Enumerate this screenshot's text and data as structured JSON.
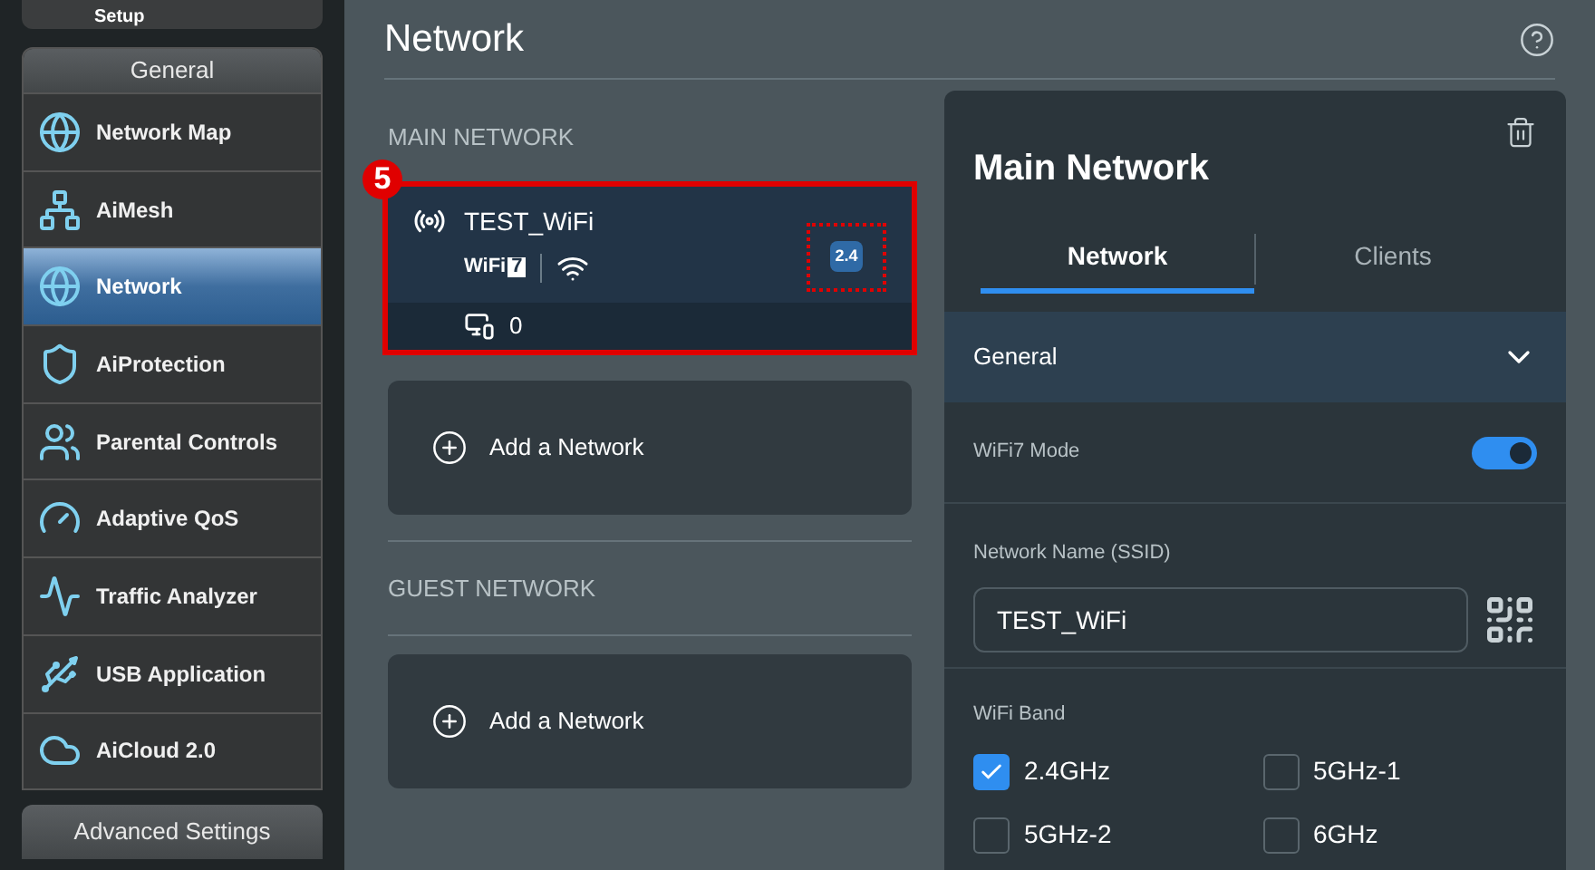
{
  "sidebar": {
    "top_item": "Setup",
    "general": {
      "title": "General",
      "items": [
        {
          "label": "Network Map",
          "selected": false
        },
        {
          "label": "AiMesh",
          "selected": false
        },
        {
          "label": "Network",
          "selected": true
        },
        {
          "label": "AiProtection",
          "selected": false
        },
        {
          "label": "Parental Controls",
          "selected": false
        },
        {
          "label": "Adaptive QoS",
          "selected": false
        },
        {
          "label": "Traffic Analyzer",
          "selected": false
        },
        {
          "label": "USB Application",
          "selected": false
        },
        {
          "label": "AiCloud 2.0",
          "selected": false
        }
      ]
    },
    "advanced_title": "Advanced Settings"
  },
  "page": {
    "title": "Network",
    "main_network": {
      "heading": "MAIN NETWORK",
      "annotation": "5",
      "network": {
        "name": "TEST_WiFi",
        "wifi_logo": "WiFi",
        "wifi_generation": "7",
        "band": "2.4",
        "clients": "0"
      },
      "add_label": "Add a Network"
    },
    "guest_network": {
      "heading": "GUEST NETWORK",
      "add_label": "Add a Network"
    }
  },
  "panel": {
    "title": "Main Network",
    "tabs": [
      {
        "label": "Network",
        "selected": true
      },
      {
        "label": "Clients",
        "selected": false
      }
    ],
    "section": {
      "title": "General",
      "expanded": true
    },
    "wifi7_mode": {
      "label": "WiFi7 Mode",
      "on": true
    },
    "ssid": {
      "label": "Network Name (SSID)",
      "value": "TEST_WiFi"
    },
    "band": {
      "label": "WiFi Band",
      "options": [
        {
          "label": "2.4GHz",
          "checked": true
        },
        {
          "label": "5GHz-1",
          "checked": false
        },
        {
          "label": "5GHz-2",
          "checked": false
        },
        {
          "label": "6GHz",
          "checked": false
        }
      ]
    }
  }
}
